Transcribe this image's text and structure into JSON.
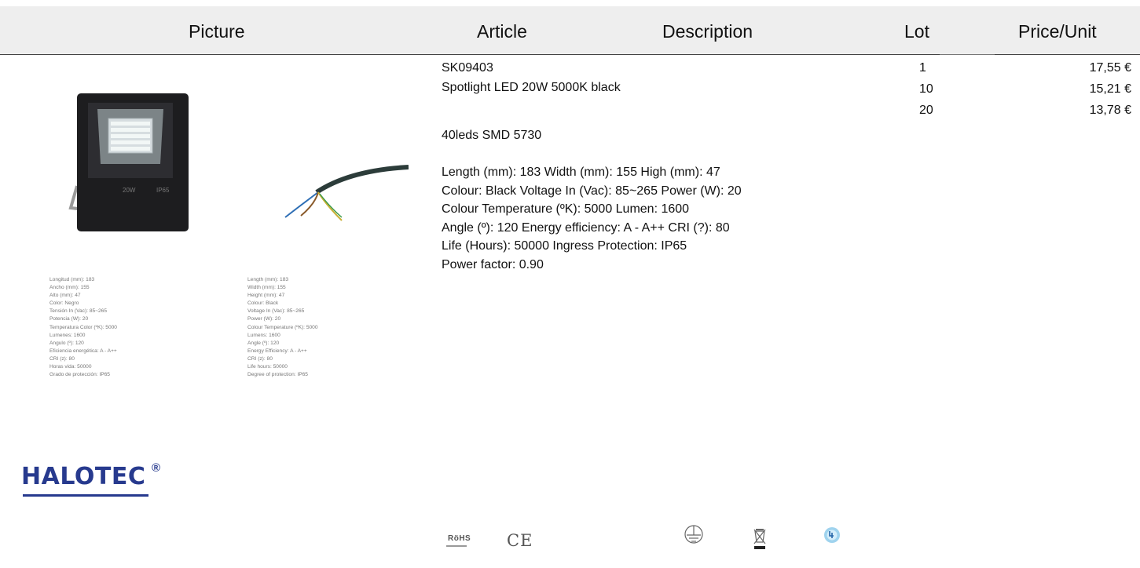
{
  "header": {
    "picture": "Picture",
    "article": "Article",
    "description": "Description",
    "lot": "Lot",
    "price": "Price/Unit"
  },
  "product": {
    "code": "SK09403",
    "name": "Spotlight LED 20W 5000K black",
    "leds": "40leds SMD 5730",
    "specs": [
      "Length (mm): 183 Width (mm): 155 High (mm): 47",
      "Colour: Black Voltage In (Vac): 85~265 Power (W): 20",
      "Colour Temperature (ºK): 5000 Lumen: 1600",
      "Angle (º): 120 Energy efficiency: A - A++ CRI (?): 80",
      "Life (Hours): 50000 Ingress Protection: IP65",
      "Power factor: 0.90"
    ],
    "lots": [
      "1",
      "10",
      "20"
    ],
    "prices": [
      "17,55 €",
      "15,21 €",
      "13,78 €"
    ]
  },
  "image_labels": {
    "housing_left": "20W",
    "housing_right": "IP65"
  },
  "small_specs_es": [
    "Longitud (mm): 183",
    "Ancho (mm): 155",
    "Alto (mm): 47",
    "Color: Negro",
    "Tensión In (Vac): 85~265",
    "Potencia (W): 20",
    "Temperatura Color (ºK): 5000",
    "Lumenes: 1600",
    "Angulo (º): 120",
    "Eficiencia energética: A - A++",
    "CRI (z): 80",
    "Horas vida: 50000",
    "Grado de protección: IP65"
  ],
  "small_specs_en": [
    "Length (mm): 183",
    "Width (mm): 155",
    "Height (mm): 47",
    "Colour: Black",
    "Voltage In (Vac): 85~265",
    "Power (W): 20",
    "Colour Temperature (ºK): 5000",
    "Lumens: 1600",
    "Angle (º): 120",
    "Energy Efficiency: A - A++",
    "CRI (z): 80",
    "Life hours: 50000",
    "Degree of protection: IP65"
  ],
  "brand": {
    "name": "HALOTEC",
    "registered": "®",
    "color": "#273a8e"
  },
  "certifications": {
    "rohs": "RöHS",
    "ce": "CE",
    "icons": [
      "ground-symbol-icon",
      "weee-bin-icon",
      "ip65-icon"
    ]
  }
}
